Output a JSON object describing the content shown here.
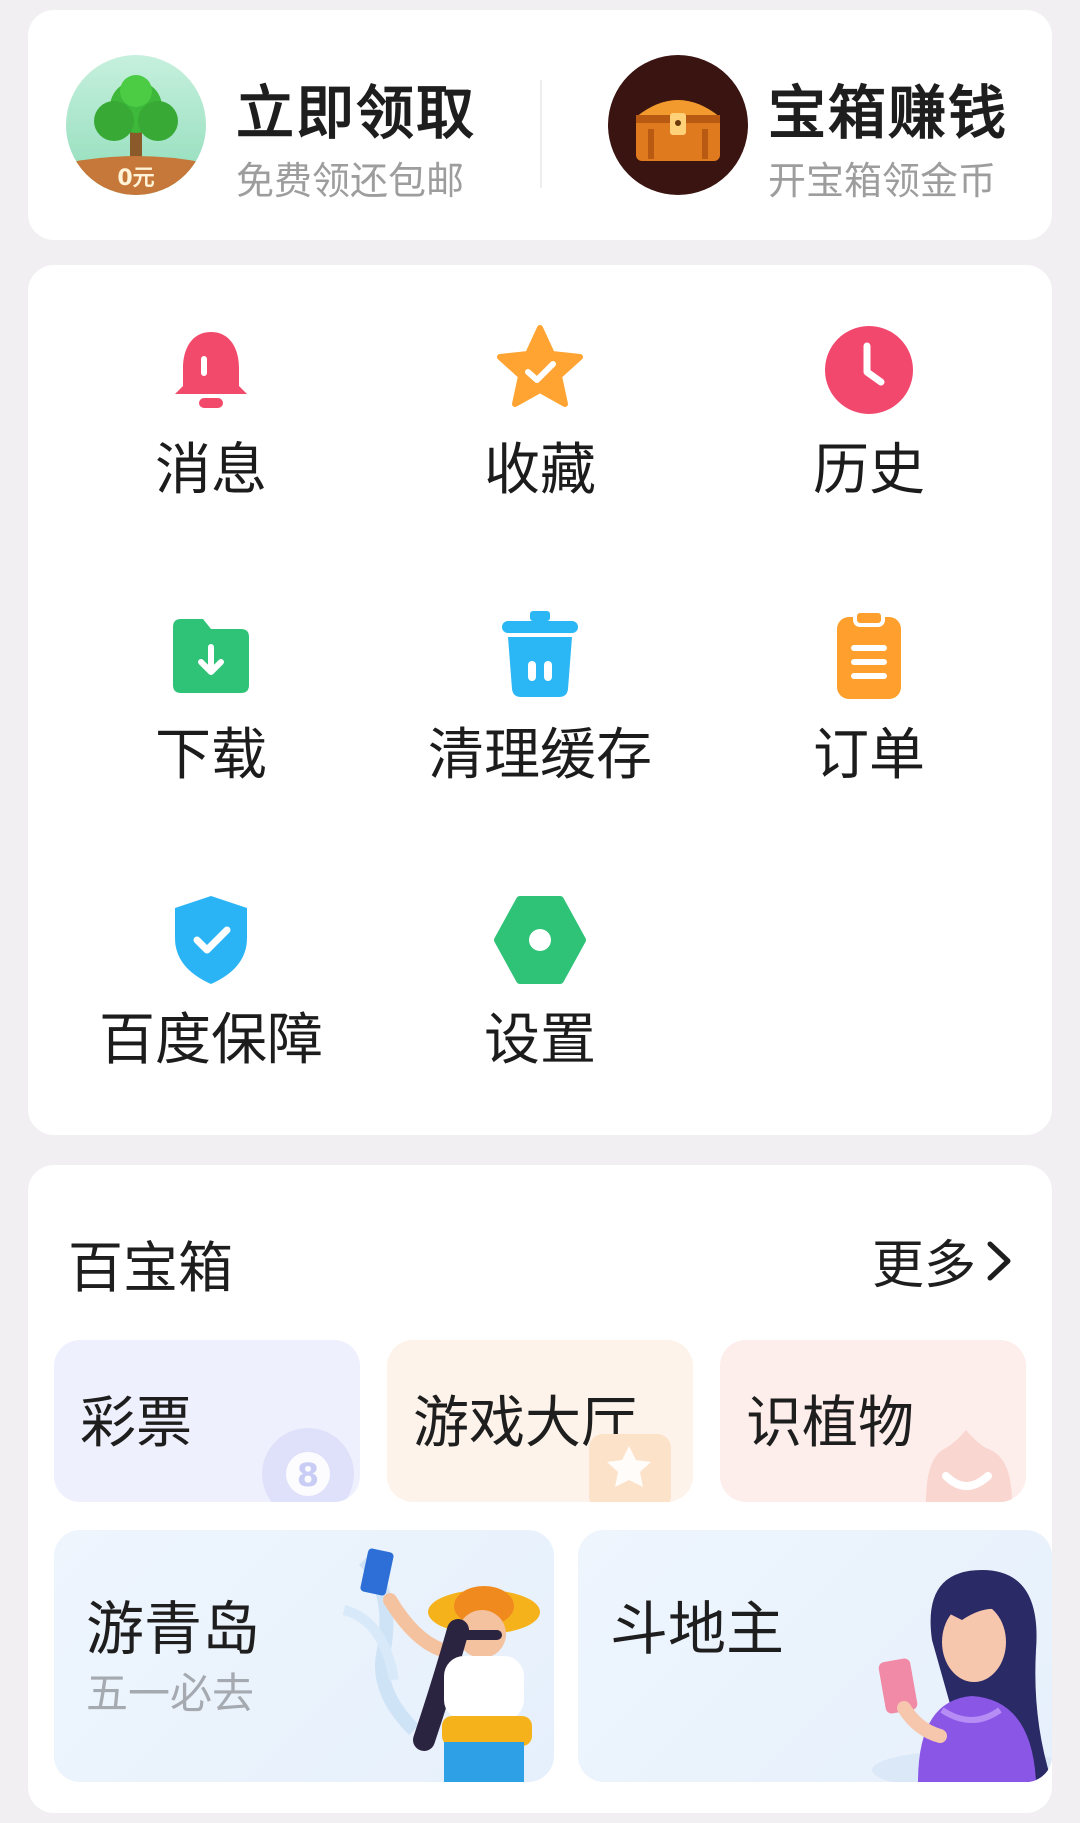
{
  "promo": {
    "left": {
      "title": "立即领取",
      "subtitle": "免费领还包邮",
      "badge": "0元",
      "icon": "money-tree-icon"
    },
    "right": {
      "title": "宝箱赚钱",
      "subtitle": "开宝箱领金币",
      "icon": "treasure-chest-icon"
    }
  },
  "menu": {
    "items": [
      {
        "label": "消息",
        "icon": "bell-icon",
        "color": "#f24a6a"
      },
      {
        "label": "收藏",
        "icon": "star-icon",
        "color": "#ffa432"
      },
      {
        "label": "历史",
        "icon": "clock-icon",
        "color": "#f2486e"
      },
      {
        "label": "下载",
        "icon": "download-folder-icon",
        "color": "#2fc377"
      },
      {
        "label": "清理缓存",
        "icon": "trash-bin-icon",
        "color": "#2bb7f6"
      },
      {
        "label": "订单",
        "icon": "clipboard-icon",
        "color": "#ff9f2d"
      },
      {
        "label": "百度保障",
        "icon": "shield-check-icon",
        "color": "#2ab4f5"
      },
      {
        "label": "设置",
        "icon": "settings-hexagon-icon",
        "color": "#2fc377"
      }
    ]
  },
  "toolbox": {
    "title": "百宝箱",
    "more_label": "更多",
    "small_tiles": [
      {
        "label": "彩票",
        "bg": "#eff0fd",
        "icon": "lottery-ball-icon"
      },
      {
        "label": "游戏大厅",
        "bg": "#fdf3ea",
        "icon": "game-star-icon"
      },
      {
        "label": "识植物",
        "bg": "#fdeeec",
        "icon": "lotus-icon"
      }
    ],
    "big_tiles": [
      {
        "label": "游青岛",
        "subtitle": "五一必去",
        "bg": "#edf4fd",
        "illustration": "traveler-selfie-illustration"
      },
      {
        "label": "斗地主",
        "bg": "#edf4fd",
        "illustration": "woman-with-phone-illustration"
      }
    ]
  }
}
